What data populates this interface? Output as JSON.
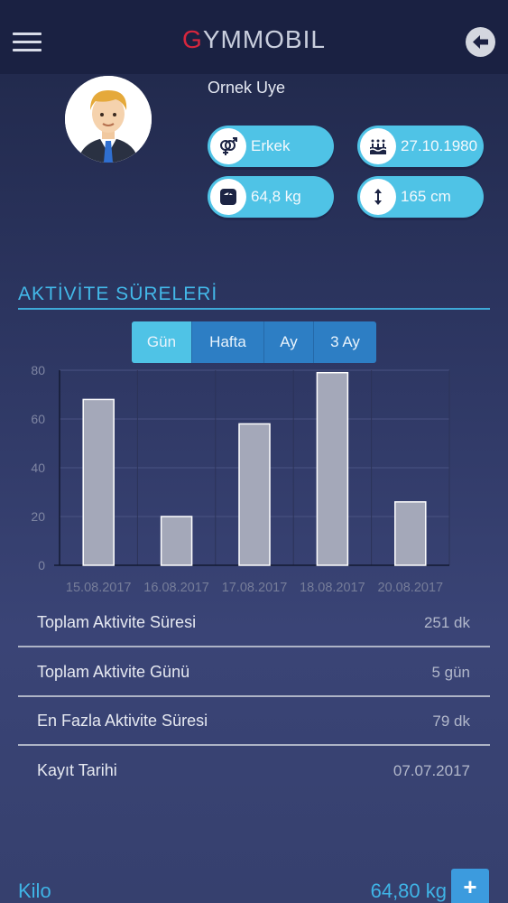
{
  "header": {
    "brand_first": "G",
    "brand_rest": "YMMOBIL",
    "menu_icon": "hamburger-menu-icon",
    "back_icon": "arrow-left-icon"
  },
  "profile": {
    "name": "Ornek Uye",
    "gender": "Erkek",
    "birthdate": "27.10.1980",
    "weight": "64,8 kg",
    "height": "165 cm"
  },
  "activity": {
    "title": "AKTİVİTE SÜRELERİ",
    "tabs": [
      {
        "label": "Gün",
        "active": true
      },
      {
        "label": "Hafta",
        "active": false
      },
      {
        "label": "Ay",
        "active": false
      },
      {
        "label": "3 Ay",
        "active": false
      }
    ]
  },
  "chart_data": {
    "type": "bar",
    "categories": [
      "15.08.2017",
      "16.08.2017",
      "17.08.2017",
      "18.08.2017",
      "20.08.2017"
    ],
    "values": [
      68,
      20,
      58,
      79,
      26
    ],
    "ylim": [
      0,
      80
    ],
    "yticks": [
      0,
      20,
      40,
      60,
      80
    ],
    "grid": true,
    "bar_color": "#a4a8b9"
  },
  "stats": [
    {
      "label": "Toplam Aktivite Süresi",
      "value": "251 dk"
    },
    {
      "label": "Toplam Aktivite Günü",
      "value": "5 gün"
    },
    {
      "label": "En Fazla Aktivite Süresi",
      "value": "79 dk"
    },
    {
      "label": "Kayıt Tarihi",
      "value": "07.07.2017"
    }
  ],
  "weight_section": {
    "label": "Kilo",
    "value": "64,80 kg",
    "add_label": "+"
  },
  "colors": {
    "accent": "#4fc3e6",
    "brand_red": "#d7263d",
    "tab_bg": "#2d7ec4"
  }
}
